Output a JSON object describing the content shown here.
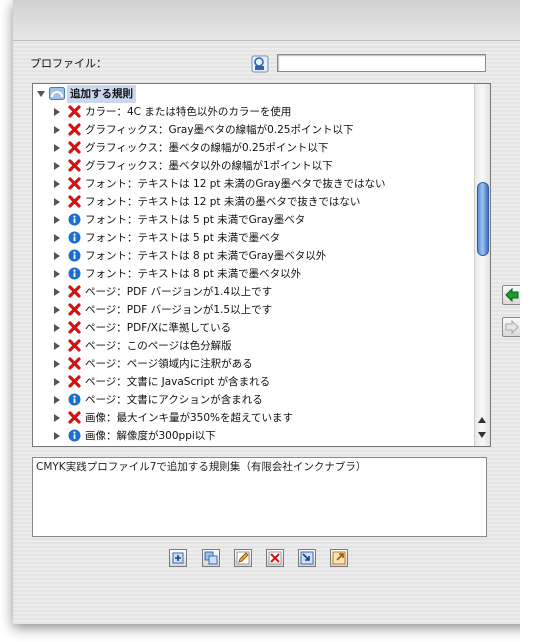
{
  "profile": {
    "label": "プロファイル：",
    "value": ""
  },
  "tree": {
    "root_label": "追加する規則",
    "items": [
      {
        "status": "error",
        "text": "カラー：4C または特色以外のカラーを使用"
      },
      {
        "status": "error",
        "text": "グラフィックス：Gray墨ベタの線幅が0.25ポイント以下"
      },
      {
        "status": "error",
        "text": "グラフィックス：墨ベタの線幅が0.25ポイント以下"
      },
      {
        "status": "error",
        "text": "グラフィックス：墨ベタ以外の線幅が1ポイント以下"
      },
      {
        "status": "error",
        "text": "フォント：テキストは 12 pt 未満のGray墨ベタで抜きではない"
      },
      {
        "status": "error",
        "text": "フォント：テキストは 12 pt 未満の墨ベタで抜きではない"
      },
      {
        "status": "info",
        "text": "フォント：テキストは 5 pt 未満でGray墨ベタ"
      },
      {
        "status": "info",
        "text": "フォント：テキストは 5 pt 未満で墨ベタ"
      },
      {
        "status": "info",
        "text": "フォント：テキストは 8 pt 未満でGray墨ベタ以外"
      },
      {
        "status": "info",
        "text": "フォント：テキストは 8 pt 未満で墨ベタ以外"
      },
      {
        "status": "error",
        "text": "ページ：PDF バージョンが1.4以上です"
      },
      {
        "status": "error",
        "text": "ページ：PDF バージョンが1.5以上です"
      },
      {
        "status": "error",
        "text": "ページ：PDF/Xに準拠している"
      },
      {
        "status": "error",
        "text": "ページ：このページは色分解版"
      },
      {
        "status": "error",
        "text": "ページ：ページ領域内に注釈がある"
      },
      {
        "status": "error",
        "text": "ページ：文書に JavaScript が含まれる"
      },
      {
        "status": "info",
        "text": "ページ：文書にアクションが含まれる"
      },
      {
        "status": "error",
        "text": "画像：最大インキ量が350%を超えています"
      },
      {
        "status": "info",
        "text": "画像：解像度が300ppi以下"
      }
    ]
  },
  "description": "CMYK実践プロファイル7で追加する規則集（有限会社インクナブラ）",
  "colors": {
    "error": "#d81010",
    "info": "#1a6fd0",
    "accent": "#4a86d8",
    "arrow_green": "#1e9a2a"
  },
  "icons": {
    "side": [
      "add-arrow-left-icon",
      "remove-arrow-right-icon"
    ],
    "bottom": [
      "new-rule-icon",
      "duplicate-icon",
      "edit-icon",
      "delete-icon",
      "import-icon",
      "export-icon"
    ]
  }
}
